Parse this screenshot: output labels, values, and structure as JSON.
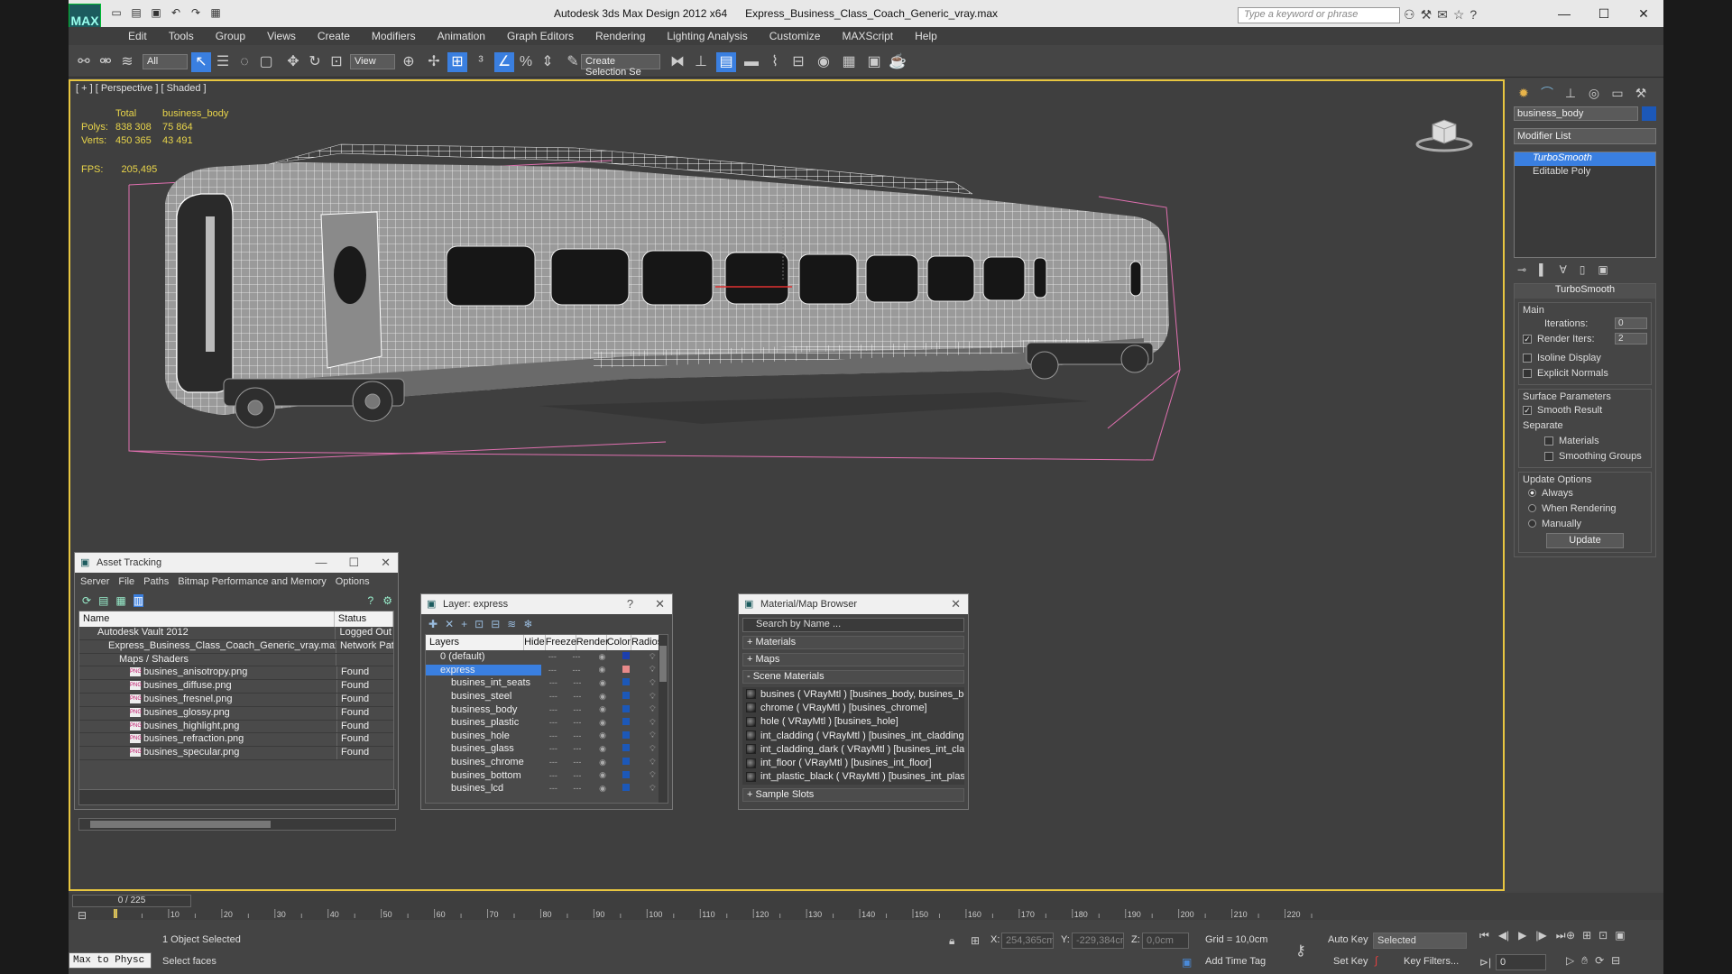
{
  "app": {
    "logo_text": "MAX",
    "title": "Autodesk 3ds Max Design 2012 x64      Express_Business_Class_Coach_Generic_vray.max",
    "search_placeholder": "Type a keyword or phrase"
  },
  "menu": [
    "Edit",
    "Tools",
    "Group",
    "Views",
    "Create",
    "Modifiers",
    "Animation",
    "Graph Editors",
    "Rendering",
    "Lighting Analysis",
    "Customize",
    "MAXScript",
    "Help"
  ],
  "toolbar": {
    "selection_filter": "All",
    "ref_coord": "View",
    "named_selection": "Create Selection Se"
  },
  "viewport": {
    "label": "[ + ] [ Perspective ] [ Shaded ]",
    "stats_header_total": "Total",
    "stats_header_object": "business_body",
    "polys_label": "Polys:",
    "polys_total": "838 308",
    "polys_object": "75 864",
    "verts_label": "Verts:",
    "verts_total": "450 365",
    "verts_object": "43 491",
    "fps_label": "FPS:",
    "fps_value": "205,495"
  },
  "command_panel": {
    "object_name": "business_body",
    "object_color": "#1c58b8",
    "modifier_list": "Modifier List",
    "stack": [
      "TurboSmooth",
      "Editable Poly"
    ],
    "rollout_title": "TurboSmooth",
    "main_group": "Main",
    "iterations_label": "Iterations:",
    "iterations_value": "0",
    "render_iters_label": "Render Iters:",
    "render_iters_value": "2",
    "isoline_label": "Isoline Display",
    "explicit_normals_label": "Explicit Normals",
    "surface_group": "Surface Parameters",
    "smooth_result_label": "Smooth Result",
    "separate_label": "Separate",
    "materials_label": "Materials",
    "smoothing_groups_label": "Smoothing Groups",
    "update_group": "Update Options",
    "always_label": "Always",
    "when_rendering_label": "When Rendering",
    "manually_label": "Manually",
    "update_button": "Update"
  },
  "asset_tracking": {
    "title": "Asset Tracking",
    "menu": [
      "Server",
      "File",
      "Paths",
      "Bitmap Performance and Memory",
      "Options"
    ],
    "col_name": "Name",
    "col_status": "Status",
    "rows": [
      {
        "name": "Autodesk Vault 2012",
        "status": "Logged Out ...",
        "indent": 20
      },
      {
        "name": "Express_Business_Class_Coach_Generic_vray.max",
        "status": "Network Path",
        "indent": 32
      },
      {
        "name": "Maps / Shaders",
        "status": "",
        "indent": 44
      },
      {
        "name": "busines_anisotropy.png",
        "status": "Found",
        "indent": 56
      },
      {
        "name": "busines_diffuse.png",
        "status": "Found",
        "indent": 56
      },
      {
        "name": "busines_fresnel.png",
        "status": "Found",
        "indent": 56
      },
      {
        "name": "busines_glossy.png",
        "status": "Found",
        "indent": 56
      },
      {
        "name": "busines_highlight.png",
        "status": "Found",
        "indent": 56
      },
      {
        "name": "busines_refraction.png",
        "status": "Found",
        "indent": 56
      },
      {
        "name": "busines_specular.png",
        "status": "Found",
        "indent": 56
      }
    ]
  },
  "layers": {
    "title": "Layer: express",
    "cols": [
      "Layers",
      "Hide",
      "Freeze",
      "Render",
      "Color",
      "Radiosity"
    ],
    "rows": [
      {
        "name": "0 (default)",
        "color": "#1c3fae",
        "indent": 16,
        "sel": false
      },
      {
        "name": "express",
        "color": "#e88a8a",
        "indent": 16,
        "sel": true
      },
      {
        "name": "busines_int_seats",
        "color": "#1c58b8",
        "indent": 28,
        "sel": false
      },
      {
        "name": "busines_steel",
        "color": "#1c58b8",
        "indent": 28,
        "sel": false
      },
      {
        "name": "business_body",
        "color": "#1c58b8",
        "indent": 28,
        "sel": false
      },
      {
        "name": "busines_plastic",
        "color": "#1c58b8",
        "indent": 28,
        "sel": false
      },
      {
        "name": "busines_hole",
        "color": "#1c58b8",
        "indent": 28,
        "sel": false
      },
      {
        "name": "busines_glass",
        "color": "#1c58b8",
        "indent": 28,
        "sel": false
      },
      {
        "name": "busines_chrome",
        "color": "#1c58b8",
        "indent": 28,
        "sel": false
      },
      {
        "name": "busines_bottom",
        "color": "#1c58b8",
        "indent": 28,
        "sel": false
      },
      {
        "name": "busines_lcd",
        "color": "#1c58b8",
        "indent": 28,
        "sel": false
      }
    ]
  },
  "material_browser": {
    "title": "Material/Map Browser",
    "search_placeholder": "Search by Name ...",
    "sections": [
      "+ Materials",
      "+ Maps",
      "- Scene Materials"
    ],
    "scene_materials": [
      "busines ( VRayMtl ) [busines_body, busines_body...",
      "chrome ( VRayMtl ) [busines_chrome]",
      "hole ( VRayMtl ) [busines_hole]",
      "int_cladding ( VRayMtl ) [busines_int_cladding, bu...",
      "int_cladding_dark ( VRayMtl ) [busines_int_claddi...",
      "int_floor ( VRayMtl ) [busines_int_floor]",
      "int_plastic_black ( VRayMtl ) [busines_int_plastic]"
    ],
    "sample_slots": "+ Sample Slots"
  },
  "timeline": {
    "frame": "0 / 225",
    "tick_labels": [
      "10",
      "20",
      "30",
      "40",
      "50",
      "60",
      "70",
      "80",
      "90",
      "100",
      "110",
      "120",
      "130",
      "140",
      "150",
      "160",
      "170",
      "180",
      "190",
      "200",
      "210",
      "220"
    ]
  },
  "status": {
    "maxscript": "Max to Physc",
    "selected_count": "1 Object Selected",
    "prompt": "Select faces",
    "x_label": "X:",
    "x_value": "254,365cm",
    "y_label": "Y:",
    "y_value": "-229,384cm",
    "z_label": "Z:",
    "z_value": "0,0cm",
    "grid": "Grid = 10,0cm",
    "add_time_tag": "Add Time Tag",
    "auto_key": "Auto Key",
    "selected_dropdown": "Selected",
    "set_key": "Set Key",
    "key_filters": "Key Filters...",
    "current_frame": "0"
  }
}
